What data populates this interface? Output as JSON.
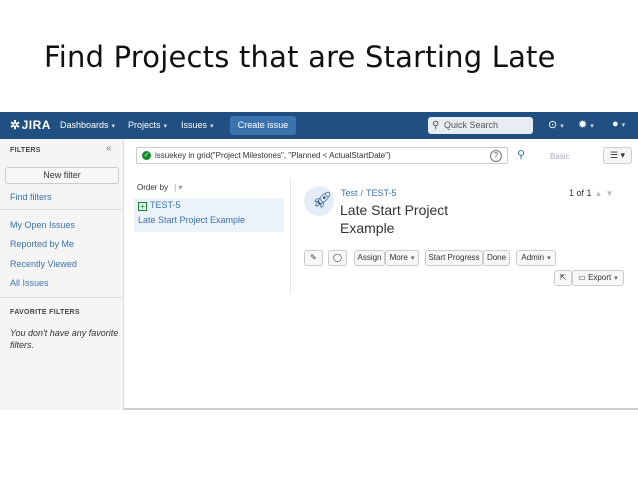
{
  "slide": {
    "title": "Find Projects that are Starting Late"
  },
  "nav": {
    "logo": "JIRA",
    "items": [
      "Dashboards",
      "Projects",
      "Issues"
    ],
    "create_label": "Create issue",
    "quick_search_placeholder": "Quick Search",
    "help_icon": "help-icon",
    "settings_icon": "gear-icon",
    "user_icon": "user-avatar-icon",
    "brand_color": "#205081",
    "create_color": "#3b73af"
  },
  "sidebar": {
    "filters_heading": "FILTERS",
    "new_filter_label": "New filter",
    "find_filters": "Find filters",
    "links": [
      "My Open Issues",
      "Reported by Me",
      "Recently Viewed",
      "All Issues"
    ],
    "favorite_heading": "FAVORITE FILTERS",
    "no_favorites": "You don't have any favorite filters."
  },
  "search": {
    "query": "issuekey in grid(\"Project Milestones\", \"Planned < ActualStartDate\")",
    "basic_label": "Basic"
  },
  "list": {
    "order_by": "Order by",
    "issue_key": "TEST-5",
    "issue_summary": "Late Start Project Example"
  },
  "detail": {
    "project": "Test",
    "issue_key": "TEST-5",
    "title_line1": "Late Start Project",
    "title_line2": "Example",
    "pager": "1 of 1",
    "buttons": {
      "assign": "Assign",
      "more": "More",
      "start_progress": "Start Progress",
      "done": "Done",
      "admin": "Admin",
      "export": "Export"
    }
  }
}
